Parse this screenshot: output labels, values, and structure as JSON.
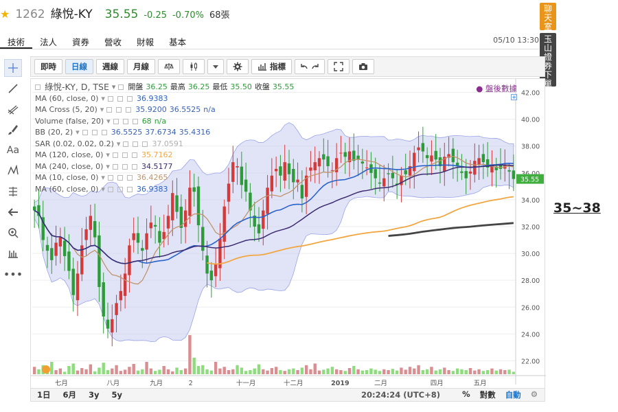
{
  "header": {
    "code": "1262",
    "name": "綠悅-KY",
    "price": "35.55",
    "change": "-0.25",
    "change_pct": "-0.70%",
    "volume": "68張"
  },
  "tabs": [
    "技術",
    "法人",
    "資券",
    "營收",
    "財報",
    "基本"
  ],
  "timestamp": "05/10 13:30",
  "side_buttons": [
    "聊天室",
    "玉山證券下單"
  ],
  "toolbar": {
    "periods": [
      "即時",
      "日線",
      "週線",
      "月線"
    ],
    "indicators_label": "指標"
  },
  "legend": {
    "main": {
      "name": "綠悅-KY, D, TSE",
      "open_label": "開盤",
      "open": "36.25",
      "high_label": "最高",
      "high": "36.25",
      "low_label": "最低",
      "low": "35.50",
      "close_label": "收盤",
      "close": "35.55"
    },
    "rows": [
      {
        "name": "MA (60, close, 0)",
        "values": [
          "36.9383"
        ]
      },
      {
        "name": "MA Cross (5, 20)",
        "values": [
          "35.9200",
          "36.5525",
          "n/a"
        ]
      },
      {
        "name": "Volume (false, 20)",
        "values": [
          "68",
          "n/a"
        ]
      },
      {
        "name": "BB (20, 2)",
        "values": [
          "36.5525",
          "37.6734",
          "35.4316"
        ]
      },
      {
        "name": "SAR (0.02, 0.02, 0.2)",
        "values": [
          "37.0591"
        ]
      },
      {
        "name": "MA (120, close, 0)",
        "values": [
          "35.7162"
        ]
      },
      {
        "name": "MA (240, close, 0)",
        "values": [
          "34.5177"
        ]
      },
      {
        "name": "MA (10, close, 0)",
        "values": [
          "36.4265"
        ]
      },
      {
        "name": "MA (60, close, 0)",
        "values": [
          "36.9383"
        ]
      }
    ],
    "after_hours": "● 盤後數據"
  },
  "colors": {
    "up": "#d33a3a",
    "down": "#2e9b3a",
    "ma10": "#c0936a",
    "ma60": "#2a62c9",
    "ma120": "#3b2a6f",
    "ma240": "#f2a640",
    "bb_fill": "#c9cdf0",
    "accent": "#1b73c9"
  },
  "chart_data": {
    "type": "candlestick",
    "y_axis": {
      "ticks": [
        "42.00",
        "40.00",
        "38.00",
        "36.00",
        "34.00",
        "32.00",
        "30.00",
        "28.00",
        "26.00",
        "24.00",
        "22.00"
      ],
      "range": [
        21,
        43
      ]
    },
    "x_axis_labels": [
      "七月",
      "八月",
      "九月",
      "2",
      "十一月",
      "十二月",
      "2019",
      "二月",
      "四月",
      "五月"
    ],
    "last_price_label": "35.55",
    "close": [
      33.2,
      32.8,
      31.0,
      30.2,
      29.5,
      30.8,
      31.2,
      29.8,
      28.7,
      26.9,
      28.5,
      30.6,
      31.8,
      32.8,
      31.2,
      27.5,
      25.3,
      24.4,
      25.1,
      26.3,
      27.2,
      28.5,
      30.6,
      31.5,
      30.8,
      30.2,
      31.5,
      32.3,
      32.0,
      30.8,
      31.6,
      32.8,
      34.5,
      33.1,
      31.9,
      33.2,
      34.9,
      34.6,
      32.1,
      30.2,
      28.5,
      28.0,
      29.2,
      31.1,
      33.5,
      35.2,
      36.8,
      36.5,
      35.1,
      34.6,
      33.2,
      32.0,
      31.5,
      33.2,
      34.9,
      35.8,
      36.3,
      35.8,
      36.8,
      35.9,
      35.3,
      35.5,
      34.1,
      35.8,
      36.4,
      36.8,
      37.1,
      37.0,
      36.5,
      36.2,
      37.1,
      37.5,
      37.2,
      37.6,
      36.9,
      37.0,
      36.7,
      36.4,
      36.0,
      35.6,
      35.2,
      35.6,
      35.9,
      35.6,
      35.1,
      35.8,
      35.9,
      36.5,
      37.5,
      37.9,
      37.6,
      37.1,
      37.3,
      37.0,
      36.5,
      37.2,
      37.4,
      36.8,
      36.5,
      36.0,
      35.6,
      36.1,
      36.9,
      37.1,
      36.8,
      36.4,
      36.6,
      36.2,
      36.3,
      36.6,
      36.1,
      35.55
    ]
  },
  "bottom": {
    "ranges": [
      "1日",
      "6月",
      "3y",
      "5y"
    ],
    "time": "20:24:24 (UTC+8)",
    "options": [
      "%",
      "對數",
      "自動"
    ]
  },
  "annotation": "35~38"
}
